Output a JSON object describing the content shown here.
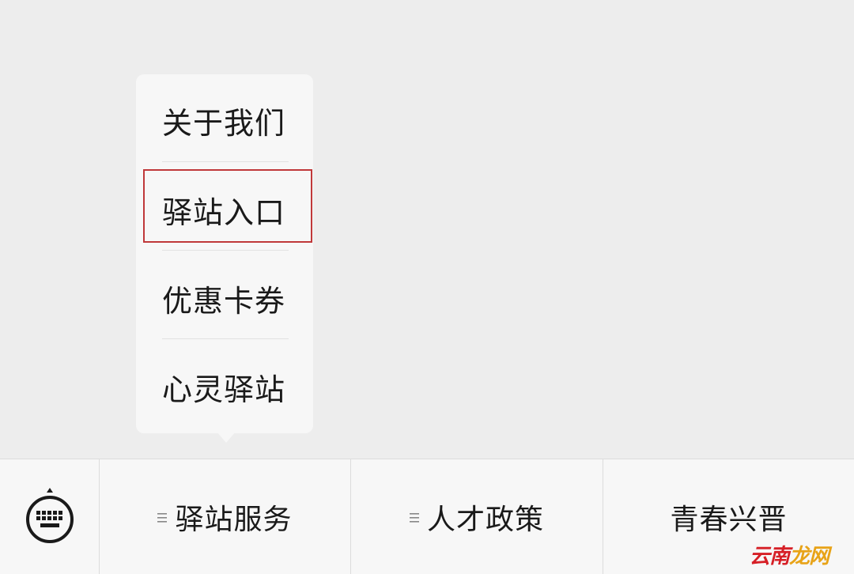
{
  "popup_menu": {
    "items": [
      {
        "label": "关于我们"
      },
      {
        "label": "驿站入口"
      },
      {
        "label": "优惠卡券"
      },
      {
        "label": "心灵驿站"
      }
    ],
    "highlighted_index": 1,
    "highlight_color": "#c0383a"
  },
  "bottom_menu": {
    "keyboard_icon": "keyboard-icon",
    "tabs": [
      {
        "label": "驿站服务",
        "has_submenu": true
      },
      {
        "label": "人才政策",
        "has_submenu": true
      },
      {
        "label": "青春兴晋",
        "has_submenu": false
      }
    ]
  },
  "watermark": {
    "part_a": "云南",
    "part_b": "龙网"
  }
}
